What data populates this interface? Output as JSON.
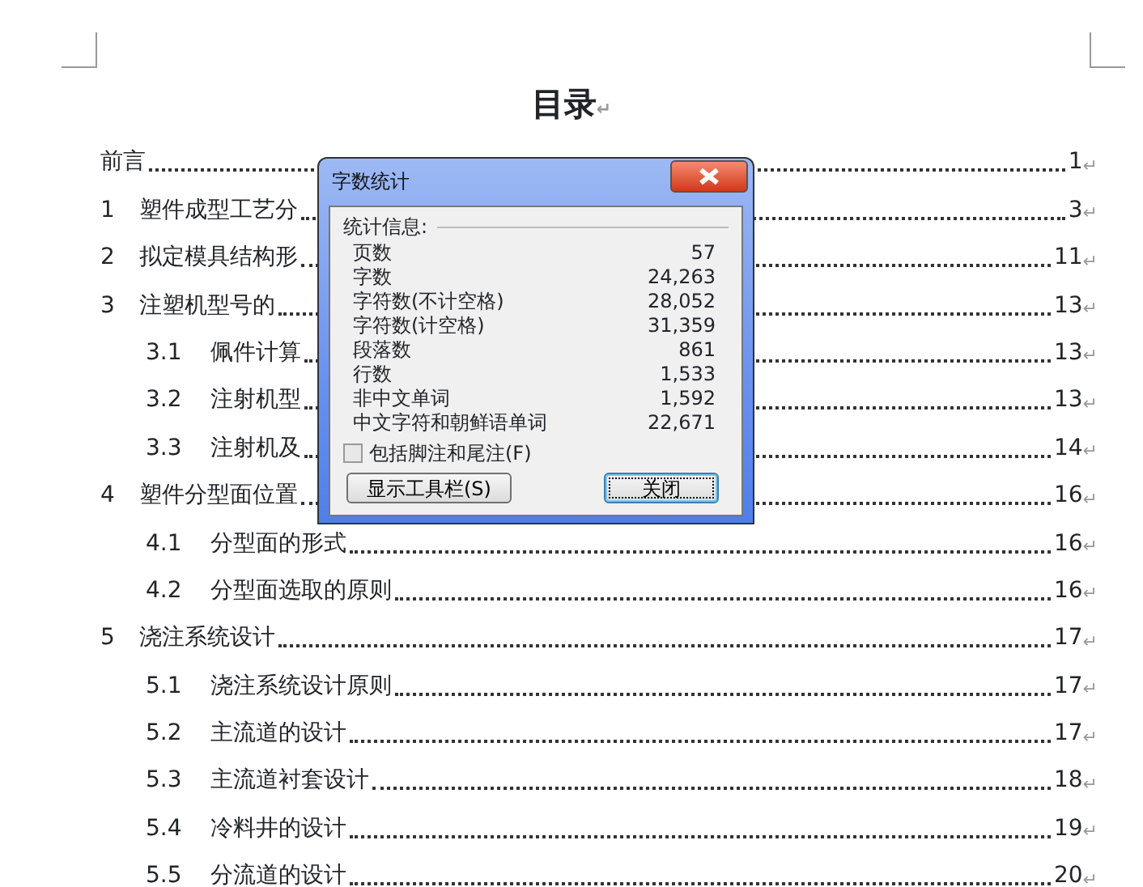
{
  "document": {
    "title": "目录",
    "title_mark": "↵",
    "toc": [
      {
        "title": "前言",
        "page": "1",
        "end_mark": "↵"
      },
      {
        "number": "1",
        "title": "塑件成型工艺分",
        "page": "3",
        "end_mark": "↵"
      },
      {
        "number": "2",
        "title": "拟定模具结构形",
        "page": "11",
        "end_mark": "↵"
      },
      {
        "number": "3",
        "title": "注塑机型号的",
        "page": "13",
        "end_mark": "↵",
        "children": [
          {
            "number": "3.1",
            "title": "佩件计算",
            "page": "13",
            "end_mark": "↵"
          },
          {
            "number": "3.2",
            "title": "注射机型",
            "page": "13",
            "end_mark": "↵"
          },
          {
            "number": "3.3",
            "title": "注射机及",
            "page": "14",
            "end_mark": "↵"
          }
        ]
      },
      {
        "number": "4",
        "title": "塑件分型面位置",
        "page": "16",
        "end_mark": "↵",
        "children": [
          {
            "number": "4.1",
            "title": "分型面的形式",
            "page": "16",
            "end_mark": "↵"
          },
          {
            "number": "4.2",
            "title": "分型面选取的原则",
            "page": "16",
            "end_mark": "↵"
          }
        ]
      },
      {
        "number": "5",
        "title": "浇注系统设计",
        "page": "17",
        "end_mark": "↵",
        "children": [
          {
            "number": "5.1",
            "title": "浇注系统设计原则",
            "page": "17",
            "end_mark": "↵"
          },
          {
            "number": "5.2",
            "title": "主流道的设计",
            "page": "17",
            "end_mark": "↵"
          },
          {
            "number": "5.3",
            "title": "主流道衬套设计",
            "page": "18",
            "end_mark": "↵"
          },
          {
            "number": "5.4",
            "title": "冷料井的设计",
            "page": "19",
            "end_mark": "↵"
          },
          {
            "number": "5.5",
            "title": "分流道的设计",
            "page": "20",
            "end_mark": "↵"
          }
        ]
      }
    ]
  },
  "dialog": {
    "title": "字数统计",
    "group_label": "统计信息:",
    "stats": [
      {
        "label": "页数",
        "value": "57"
      },
      {
        "label": "字数",
        "value": "24,263"
      },
      {
        "label": "字符数(不计空格)",
        "value": "28,052"
      },
      {
        "label": "字符数(计空格)",
        "value": "31,359"
      },
      {
        "label": "段落数",
        "value": "861"
      },
      {
        "label": "行数",
        "value": "1,533"
      },
      {
        "label": "非中文单词",
        "value": "1,592"
      },
      {
        "label": "中文字符和朝鲜语单词",
        "value": "22,671"
      }
    ],
    "checkbox": {
      "label": "包括脚注和尾注(F)",
      "checked": false
    },
    "buttons": [
      {
        "label": "显示工具栏(S)",
        "focused": false
      },
      {
        "label": "关闭",
        "focused": true
      }
    ]
  }
}
